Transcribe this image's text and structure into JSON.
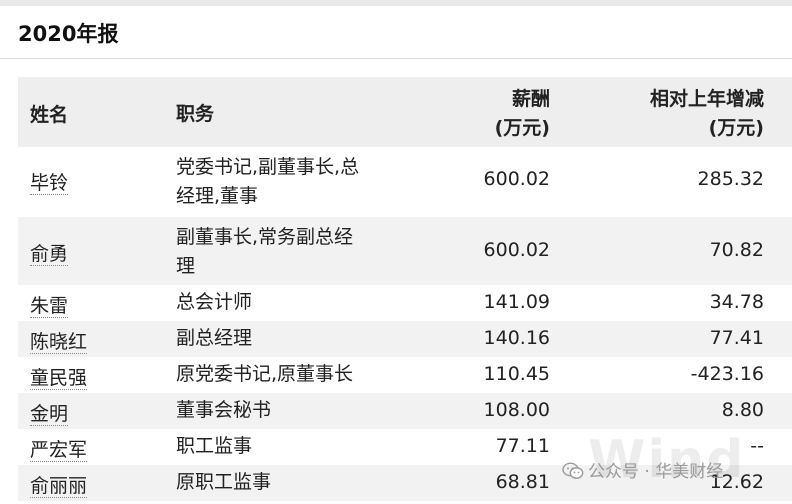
{
  "report": {
    "title": "2020年报"
  },
  "table": {
    "headers": {
      "name": "姓名",
      "position": "职务",
      "pay_line1": "薪酬",
      "pay_line2": "(万元)",
      "change_line1": "相对上年增减",
      "change_line2": "(万元)"
    },
    "rows": [
      {
        "name": "毕铃",
        "position_line1": "党委书记,副董事长,总",
        "position_line2": "经理,董事",
        "pay": "600.02",
        "change": "285.32"
      },
      {
        "name": "俞勇",
        "position_line1": "副董事长,常务副总经",
        "position_line2": "理",
        "pay": "600.02",
        "change": "70.82"
      },
      {
        "name": "朱雷",
        "position_line1": "总会计师",
        "position_line2": "",
        "pay": "141.09",
        "change": "34.78"
      },
      {
        "name": "陈晓红",
        "position_line1": "副总经理",
        "position_line2": "",
        "pay": "140.16",
        "change": "77.41"
      },
      {
        "name": "童民强",
        "position_line1": "原党委书记,原董事长",
        "position_line2": "",
        "pay": "110.45",
        "change": "-423.16"
      },
      {
        "name": "金明",
        "position_line1": "董事会秘书",
        "position_line2": "",
        "pay": "108.00",
        "change": "8.80"
      },
      {
        "name": "严宏军",
        "position_line1": "职工监事",
        "position_line2": "",
        "pay": "77.11",
        "change": "--"
      },
      {
        "name": "俞丽丽",
        "position_line1": "原职工监事",
        "position_line2": "",
        "pay": "68.81",
        "change": "12.62"
      }
    ]
  },
  "watermark": {
    "text": "公众号 · 华美财经",
    "brand": "Wind",
    "icon": "wechat-icon"
  }
}
